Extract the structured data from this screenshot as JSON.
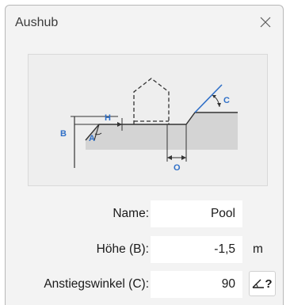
{
  "window": {
    "title": "Aushub",
    "close_icon": "close-icon"
  },
  "diagram": {
    "labels": {
      "A": "A",
      "B": "B",
      "C": "C",
      "H": "H",
      "O": "O"
    },
    "colors": {
      "accent": "#2f6fc7",
      "line": "#333333",
      "ground": "#d4d4d4"
    }
  },
  "form": {
    "name": {
      "label": "Name:",
      "value": "Pool"
    },
    "hoehe": {
      "label": "Höhe (B):",
      "value": "-1,5",
      "unit": "m"
    },
    "anstieg": {
      "label": "Anstiegswinkel (C):",
      "value": "90",
      "button_label": "?",
      "button_icon": "angle-icon"
    }
  }
}
